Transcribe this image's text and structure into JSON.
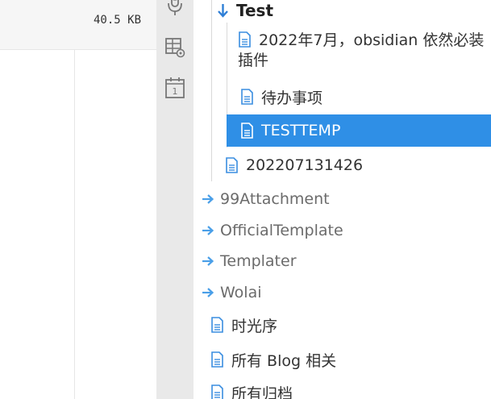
{
  "editor": {
    "file_size": "40.5 KB"
  },
  "ribbon": {
    "icons": [
      "microphone-icon",
      "table-settings-icon",
      "calendar-icon"
    ],
    "calendar_day": "1"
  },
  "colors": {
    "accent": "#2f8fe6",
    "folder_arrow": "#4a9fe8",
    "ribbon_bg": "#e9e9e9",
    "selected_text": "#ffffff"
  },
  "tree": {
    "test_folder": "Test",
    "items": [
      {
        "label_line1": "2022年7月，obsidian 依然必装",
        "label_line2": "插件"
      },
      {
        "label": "待办事项"
      },
      {
        "label": "TESTTEMP",
        "selected": true
      },
      {
        "label": "202207131426"
      }
    ],
    "folders": [
      "99Attachment",
      "OfficialTemplate",
      "Templater",
      "Wolai"
    ],
    "root_files": [
      "时光序",
      "所有 Blog 相关",
      "所有归档"
    ]
  }
}
